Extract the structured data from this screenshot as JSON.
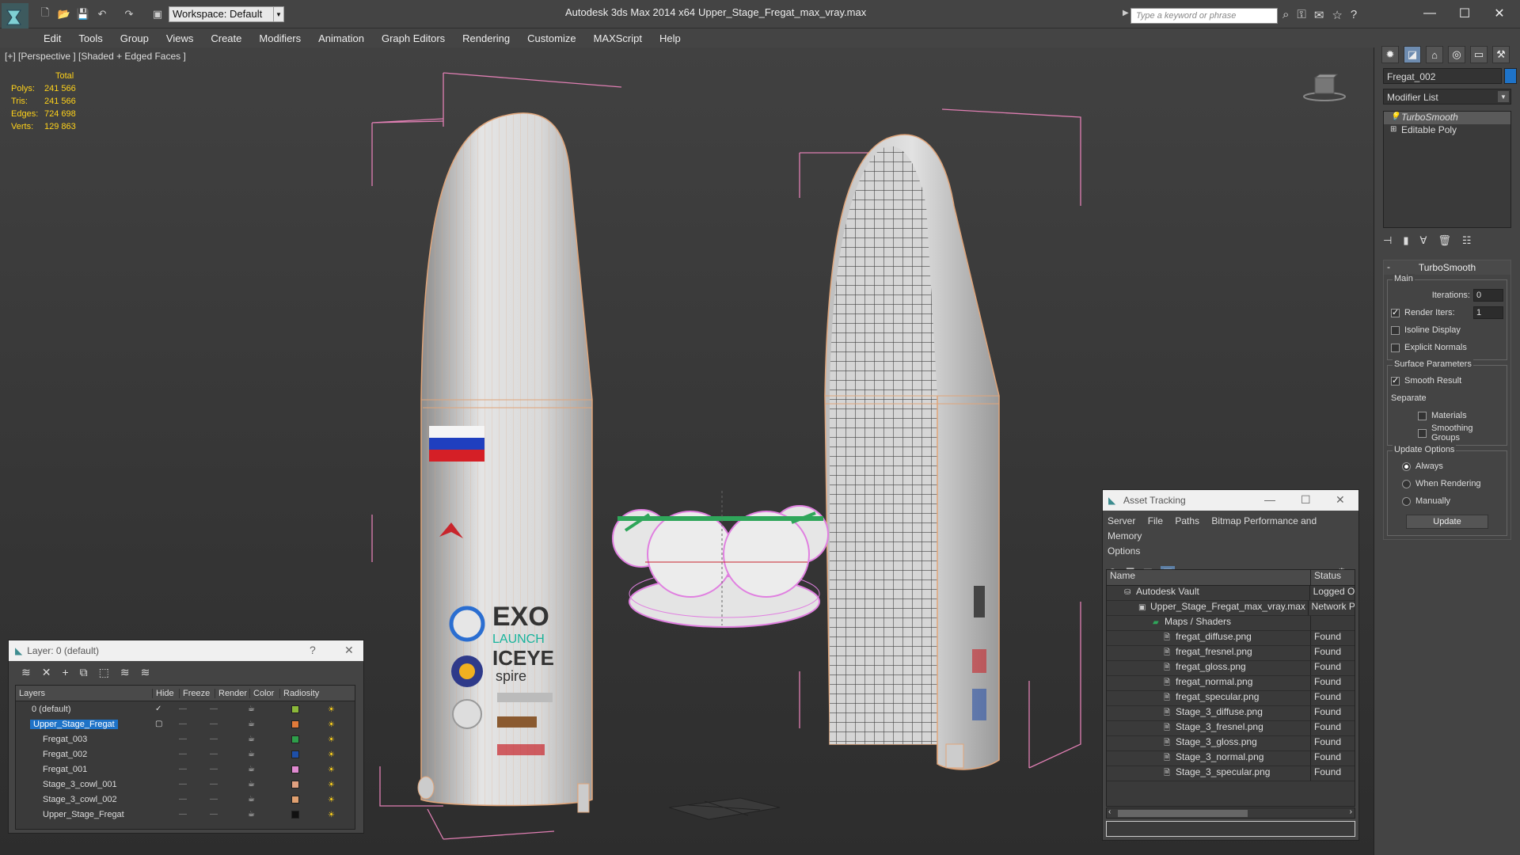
{
  "app": {
    "title": "Autodesk 3ds Max  2014 x64",
    "filename": "Upper_Stage_Fregat_max_vray.max",
    "workspace": "Workspace: Default",
    "search_placeholder": "Type a keyword or phrase"
  },
  "menu": [
    "Edit",
    "Tools",
    "Group",
    "Views",
    "Create",
    "Modifiers",
    "Animation",
    "Graph Editors",
    "Rendering",
    "Customize",
    "MAXScript",
    "Help"
  ],
  "viewport": {
    "label": "[+] [Perspective ] [Shaded + Edged Faces ]",
    "stats_header": "Total",
    "stats": [
      {
        "label": "Polys:",
        "value": "241 566"
      },
      {
        "label": "Tris:",
        "value": "241 566"
      },
      {
        "label": "Edges:",
        "value": "724 698"
      },
      {
        "label": "Verts:",
        "value": "129 863"
      }
    ]
  },
  "command_panel": {
    "object_name": "Fregat_002",
    "object_color": "#1e73c8",
    "modifier_list": "Modifier List",
    "stack": [
      "TurboSmooth",
      "Editable Poly"
    ],
    "rollout_title": "TurboSmooth",
    "main_group": "Main",
    "iterations_label": "Iterations:",
    "iterations_value": "0",
    "render_iters_label": "Render Iters:",
    "render_iters_value": "1",
    "isoline_label": "Isoline Display",
    "explicit_label": "Explicit Normals",
    "surface_group": "Surface Parameters",
    "smooth_result_label": "Smooth Result",
    "separate_label": "Separate",
    "materials_label": "Materials",
    "smoothing_groups_label": "Smoothing Groups",
    "update_group": "Update Options",
    "always_label": "Always",
    "when_rendering_label": "When Rendering",
    "manually_label": "Manually",
    "update_button": "Update"
  },
  "layer_dialog": {
    "title": "Layer: 0 (default)",
    "help": "?",
    "columns": [
      "Layers",
      "Hide",
      "Freeze",
      "Render",
      "Color",
      "Radiosity"
    ],
    "rows": [
      {
        "name": "0 (default)",
        "color": "#8bb83a"
      },
      {
        "name": "Upper_Stage_Fregat",
        "color": "#e07a3a"
      },
      {
        "name": "Fregat_003",
        "color": "#2e9e4a"
      },
      {
        "name": "Fregat_002",
        "color": "#1e4fa8"
      },
      {
        "name": "Fregat_001",
        "color": "#e08ad0"
      },
      {
        "name": "Stage_3_cowl_001",
        "color": "#e0a080"
      },
      {
        "name": "Stage_3_cowl_002",
        "color": "#e0a070"
      },
      {
        "name": "Upper_Stage_Fregat",
        "color": "#111111"
      }
    ]
  },
  "asset_tracking": {
    "title": "Asset Tracking",
    "menu": [
      "Server",
      "File",
      "Paths",
      "Bitmap Performance and Memory",
      "Options"
    ],
    "columns": [
      "Name",
      "Status"
    ],
    "rows": [
      {
        "name": "Autodesk Vault",
        "status": "Logged O"
      },
      {
        "name": "Upper_Stage_Fregat_max_vray.max",
        "status": "Network P"
      },
      {
        "name": "Maps / Shaders",
        "status": ""
      },
      {
        "name": "fregat_diffuse.png",
        "status": "Found"
      },
      {
        "name": "fregat_fresnel.png",
        "status": "Found"
      },
      {
        "name": "fregat_gloss.png",
        "status": "Found"
      },
      {
        "name": "fregat_normal.png",
        "status": "Found"
      },
      {
        "name": "fregat_specular.png",
        "status": "Found"
      },
      {
        "name": "Stage_3_diffuse.png",
        "status": "Found"
      },
      {
        "name": "Stage_3_fresnel.png",
        "status": "Found"
      },
      {
        "name": "Stage_3_gloss.png",
        "status": "Found"
      },
      {
        "name": "Stage_3_normal.png",
        "status": "Found"
      },
      {
        "name": "Stage_3_specular.png",
        "status": "Found"
      }
    ]
  },
  "fairing_text": {
    "exo": "EXO",
    "launch": "LAUNCH",
    "iceye": "ICEYE",
    "spire": "spire"
  }
}
